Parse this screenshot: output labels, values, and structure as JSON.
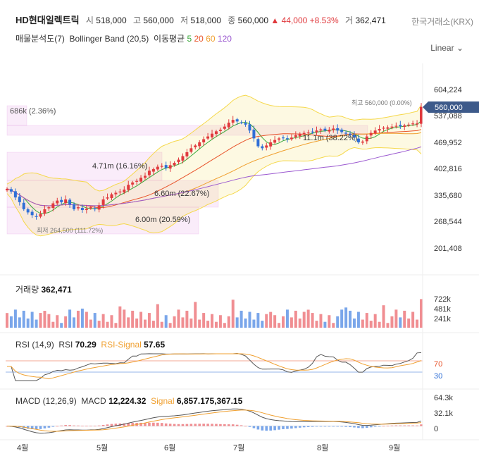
{
  "header": {
    "name": "HD현대일렉트릭",
    "open_label": "시",
    "open": "518,000",
    "high_label": "고",
    "high": "560,000",
    "low_label": "저",
    "low": "518,000",
    "close_label": "종",
    "close": "560,000",
    "change": "▲ 44,000",
    "change_pct": "+8.53%",
    "volume_label": "거",
    "volume": "362,471",
    "exchange": "한국거래소(KRX)",
    "scale_mode": "Linear"
  },
  "indicators": {
    "vp": "매물분석도(7)",
    "bb": "Bollinger Band (20,5)",
    "ma_label": "이동평균",
    "ma": [
      {
        "label": "5",
        "color": "#3aa83a"
      },
      {
        "label": "20",
        "color": "#e8532a"
      },
      {
        "label": "60",
        "color": "#f0a030"
      },
      {
        "label": "120",
        "color": "#9b59d0"
      }
    ]
  },
  "colors": {
    "up": "#e03a3e",
    "down": "#2f6fd6",
    "bb": "#f5d84a",
    "ma5": "#3aa83a",
    "ma20": "#e8532a",
    "ma60": "#f0a030",
    "ma120": "#9b59d0"
  },
  "price_axis": [
    "604,224",
    "537,088",
    "469,952",
    "402,816",
    "335,680",
    "268,544",
    "201,408"
  ],
  "last_price_tag": "560,000",
  "annotations": {
    "high": "최고 560,000 (0.00%)",
    "low": "최저 264,500 (111.72%)",
    "vp_top": "686k (2.36%)",
    "vp_labels": [
      "4.71m (16.16%)",
      "6.60m (22.67%)",
      "6.00m (20.59%)",
      "11.1m (38.22%)"
    ]
  },
  "volume_panel": {
    "label": "거래량",
    "value": "362,471",
    "ticks": [
      "722k",
      "481k",
      "241k"
    ]
  },
  "rsi_panel": {
    "label": "RSI (14,9)",
    "rsi_label": "RSI",
    "rsi": "70.29",
    "signal_label": "RSI-Signal",
    "signal": "57.65",
    "ticks": [
      "70",
      "30"
    ]
  },
  "macd_panel": {
    "label": "MACD (12,26,9)",
    "macd_label": "MACD",
    "macd": "12,224.32",
    "signal_label": "Signal",
    "signal": "6,857.175,367.15",
    "ticks": [
      "64.3k",
      "32.1k",
      "0"
    ]
  },
  "x_axis": [
    "4월",
    "5월",
    "6월",
    "7월",
    "8월",
    "9월"
  ],
  "chart_data": {
    "type": "candlestick",
    "title": "HD현대일렉트릭",
    "y_ticks": [
      604224,
      537088,
      469952,
      402816,
      335680,
      268544,
      201408
    ],
    "ylim": [
      190000,
      620000
    ],
    "months": [
      "4월",
      "5월",
      "6월",
      "7월",
      "8월",
      "9월"
    ],
    "closes": [
      352000,
      345000,
      330000,
      318000,
      300000,
      292000,
      285000,
      282000,
      288000,
      300000,
      305000,
      315000,
      322000,
      318000,
      325000,
      312000,
      300000,
      305000,
      298000,
      301000,
      305000,
      300000,
      310000,
      325000,
      330000,
      338000,
      342000,
      345000,
      350000,
      362000,
      368000,
      372000,
      380000,
      385000,
      398000,
      402000,
      408000,
      410000,
      405000,
      412000,
      418000,
      426000,
      435000,
      445000,
      455000,
      462000,
      470000,
      478000,
      485000,
      492000,
      498000,
      502000,
      510000,
      520000,
      527000,
      523000,
      520000,
      515000,
      500000,
      480000,
      460000,
      455000,
      462000,
      470000,
      476000,
      480000,
      482000,
      478000,
      482000,
      488000,
      492000,
      494000,
      495000,
      497000,
      500000,
      503000,
      500000,
      502000,
      505000,
      500000,
      496000,
      492000,
      488000,
      482000,
      470000,
      472000,
      485000,
      494000,
      500000,
      504000,
      507000,
      508000,
      510000,
      512000,
      511000,
      513000,
      515000,
      518000,
      518000,
      560000
    ],
    "volume_max": 800000,
    "rsi_levels": [
      70,
      30
    ],
    "macd_ylim": [
      -32000,
      70000
    ]
  }
}
